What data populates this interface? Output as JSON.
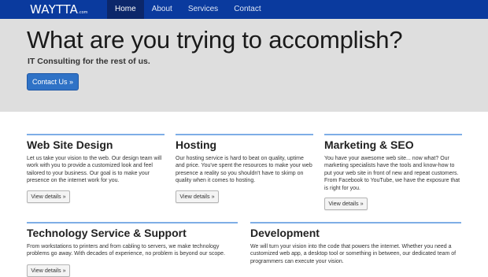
{
  "navbar": {
    "logo": "WAYTTA",
    "logo_suffix": ".com",
    "items": [
      {
        "label": "Home",
        "active": true
      },
      {
        "label": "About"
      },
      {
        "label": "Services"
      },
      {
        "label": "Contact"
      }
    ]
  },
  "hero": {
    "title": "What are you trying to accomplish?",
    "subtitle": "IT Consulting for the rest of us.",
    "button": "Contact Us »"
  },
  "sections": [
    {
      "title": "Web Site Design",
      "text": "Let us take your vision to the web. Our design team will work with you to provide a customized look and feel tailored to your business. Our goal is to make your presence on the internet work for you.",
      "button": "View details »"
    },
    {
      "title": "Hosting",
      "text": "Our hosting service is hard to beat on quality, uptime and price. You've spent the resources to make your web presence a reality so you shouldn't have to skimp on quality when it comes to hosting.",
      "button": "View details »"
    },
    {
      "title": "Marketing & SEO",
      "text": "You have your awesome web site... now what? Our marketing specialists have the tools and know-how to put your web site in front of new and repeat customers. From Facebook to YouTube, we have the exposure that is right for you.",
      "button": "View details »"
    },
    {
      "title": "Technology Service & Support",
      "text": "From workstations to printers and from cabling to servers, we make technology problems go away. With decades of experience, no problem is beyond our scope.",
      "button": "View details »"
    },
    {
      "title": "Development",
      "text": "We will turn your vision into the code that powers the internet. Whether you need a customized web app, a desktop tool or something in between, our dedicated team of programmers can execute your vision."
    }
  ],
  "colors": {
    "navbar": "#0a3a9e",
    "nav_active": "#0c276a",
    "hero_background": "#dedede",
    "primary_button": "#2f72c6",
    "section_rule": "#7eaee6"
  }
}
